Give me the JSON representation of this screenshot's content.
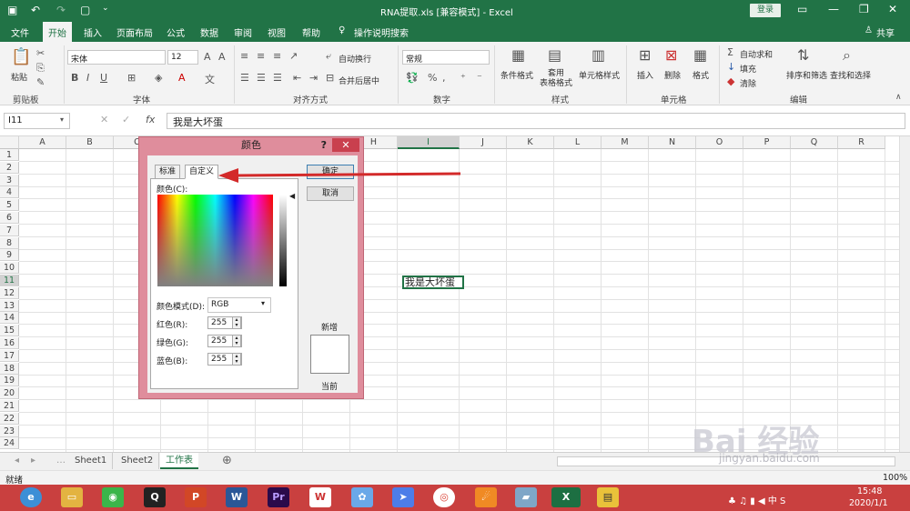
{
  "window": {
    "title": "RNA提取.xls  [兼容模式]  -  Excel",
    "login": "登录"
  },
  "menu": {
    "tabs": [
      "文件",
      "开始",
      "插入",
      "页面布局",
      "公式",
      "数据",
      "审阅",
      "视图",
      "帮助"
    ],
    "tell_me": "操作说明搜索",
    "share": "共享"
  },
  "ribbon": {
    "clipboard": {
      "label": "剪贴板",
      "paste": "粘贴"
    },
    "font": {
      "label": "字体",
      "name": "宋体",
      "size": "12"
    },
    "alignment": {
      "label": "对齐方式",
      "wrap": "自动换行",
      "merge": "合并后居中"
    },
    "number": {
      "label": "数字",
      "format": "常规"
    },
    "styles": {
      "label": "样式",
      "conditional": "条件格式",
      "table": "套用\n表格格式",
      "cell": "单元格样式"
    },
    "cells": {
      "label": "单元格",
      "insert": "插入",
      "delete": "删除",
      "format": "格式"
    },
    "editing": {
      "label": "编辑",
      "autosum": "自动求和",
      "fill": "填充",
      "clear": "清除",
      "sort": "排序和筛选",
      "find": "查找和选择"
    }
  },
  "formula": {
    "namebox": "I11",
    "value": "我是大坏蛋"
  },
  "sheet": {
    "columns": [
      "A",
      "B",
      "C",
      "D",
      "E",
      "F",
      "G",
      "H",
      "I",
      "J",
      "K",
      "L",
      "M",
      "N",
      "O",
      "P",
      "Q",
      "R"
    ],
    "rows": [
      "1",
      "2",
      "3",
      "4",
      "5",
      "6",
      "7",
      "8",
      "9",
      "10",
      "11",
      "12",
      "13",
      "14",
      "15",
      "16",
      "17",
      "18",
      "19",
      "20",
      "21",
      "22",
      "23",
      "24"
    ],
    "active_cell_text": "我是大坏蛋"
  },
  "dialog": {
    "title": "颜色",
    "help": "?",
    "close": "✕",
    "tabs": [
      "标准",
      "自定义"
    ],
    "ok": "确定",
    "cancel": "取消",
    "color_label": "颜色(C):",
    "model_label": "颜色模式(D):",
    "model_value": "RGB",
    "red_label": "红色(R):",
    "green_label": "绿色(G):",
    "blue_label": "蓝色(B):",
    "red": "255",
    "green": "255",
    "blue": "255",
    "new_label": "新增",
    "current_label": "当前"
  },
  "sheet_tabs": [
    "Sheet1",
    "Sheet2",
    "工作表"
  ],
  "status": {
    "text": "就绪",
    "zoom": "100%"
  },
  "taskbar": {
    "time": "15:48",
    "date": "2020/1/1"
  },
  "watermark": {
    "main": "Bai 经验",
    "sub": "jingyan.baidu.com"
  },
  "colors": {
    "excel_green": "#217346",
    "dialog_pink": "#df8d9c",
    "taskbar_red": "#c9403f",
    "arrow_red": "#d32a2a"
  }
}
